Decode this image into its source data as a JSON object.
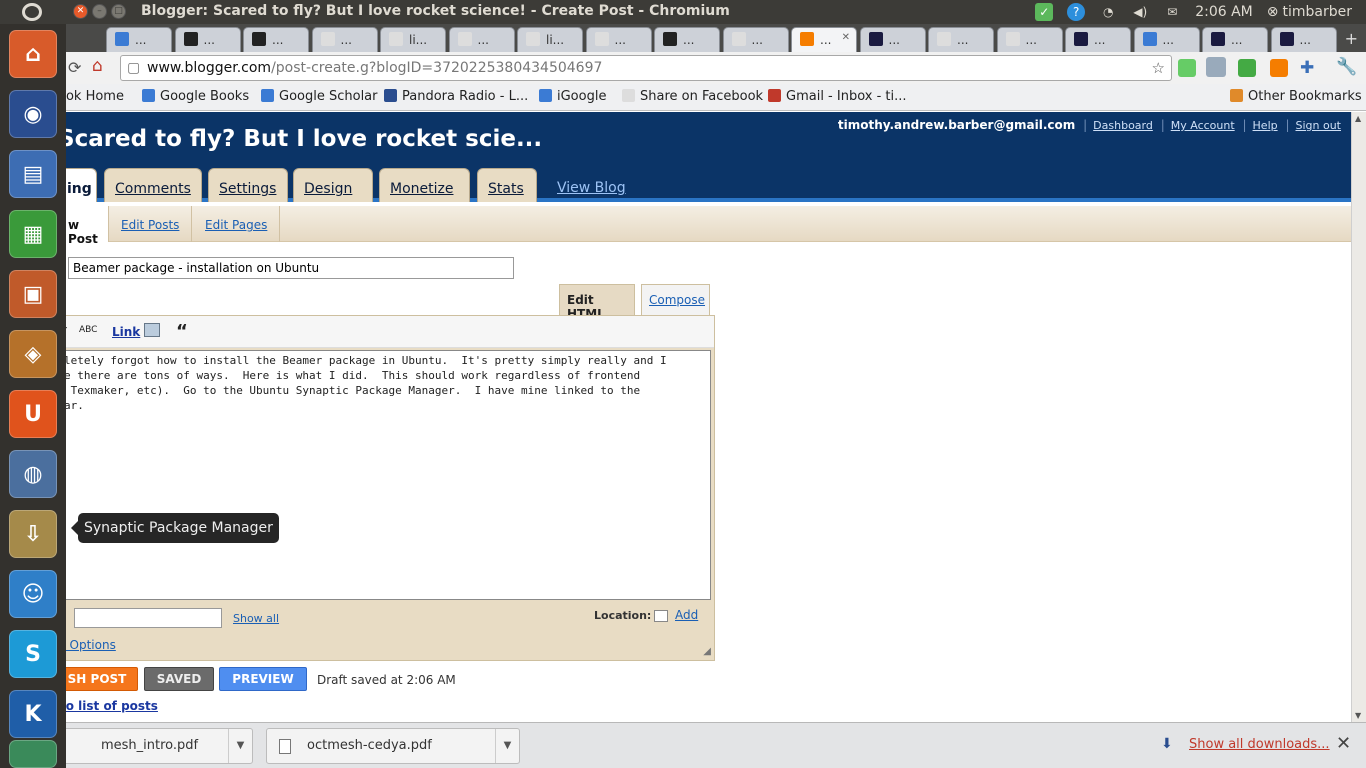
{
  "window": {
    "title": "Blogger: Scared to fly? But I love rocket science! - Create Post - Chromium"
  },
  "panel": {
    "time": "2:06 AM",
    "user": "timbarber"
  },
  "tabs": [
    {
      "label": "...",
      "color": "#3b7bd4"
    },
    {
      "label": "...",
      "color": "#222222"
    },
    {
      "label": "...",
      "color": "#222222"
    },
    {
      "label": "...",
      "color": "#dddddd"
    },
    {
      "label": "li...",
      "color": "#dddddd"
    },
    {
      "label": "...",
      "color": "#dddddd"
    },
    {
      "label": "li...",
      "color": "#dddddd"
    },
    {
      "label": "...",
      "color": "#dddddd"
    },
    {
      "label": "...",
      "color": "#222222"
    },
    {
      "label": "...",
      "color": "#dddddd"
    },
    {
      "label": "...",
      "color": "#f57d00"
    },
    {
      "label": "...",
      "color": "#1a1a40"
    },
    {
      "label": "...",
      "color": "#dddddd"
    },
    {
      "label": "...",
      "color": "#dddddd"
    },
    {
      "label": "...",
      "color": "#1a1a40"
    },
    {
      "label": "...",
      "color": "#3b7bd4"
    },
    {
      "label": "...",
      "color": "#1a1a40"
    },
    {
      "label": "...",
      "color": "#1a1a40"
    }
  ],
  "omnibox": {
    "host": "www.blogger.com",
    "path": "/post-create.g?blogID=3720225380434504697"
  },
  "bookmarks": [
    {
      "label": "ook Home"
    },
    {
      "label": "Google Books"
    },
    {
      "label": "Google Scholar"
    },
    {
      "label": "Pandora Radio - L..."
    },
    {
      "label": "iGoogle"
    },
    {
      "label": "Share on Facebook"
    },
    {
      "label": "Gmail - Inbox - ti..."
    }
  ],
  "other_bookmarks": "Other Bookmarks",
  "blog": {
    "title": "Scared to fly? But I love rocket scie...",
    "email": "timothy.andrew.barber@gmail.com",
    "links": [
      "Dashboard",
      "My Account",
      "Help",
      "Sign out"
    ],
    "tabs": [
      "ing",
      "Comments",
      "Settings",
      "Design",
      "Monetize",
      "Stats"
    ],
    "view_blog": "View Blog",
    "subtabs": [
      "w Post",
      "Edit Posts",
      "Edit Pages"
    ]
  },
  "editor": {
    "post_title": "Beamer package - installation on Ubuntu",
    "mode_tabs": {
      "html": "Edit HTML",
      "compose": "Compose"
    },
    "tool_link": "Link",
    "body": "letely forgot how to install the Beamer package in Ubuntu.  It's pretty simply really and I\ne there are tons of ways.  Here is what I did.  This should work regardless of frontend\n Texmaker, etc).  Go to the Ubuntu Synaptic Package Manager.  I have mine linked to the\nar.",
    "labels_show_all": "Show all",
    "location_label": "Location:",
    "location_add": "Add",
    "options_link": "t Options"
  },
  "actions": {
    "publish": "SH POST",
    "saved": "SAVED",
    "preview": "PREVIEW",
    "draft_status": "Draft saved at 2:06 AM",
    "back": "to list of posts"
  },
  "downloads": {
    "items": [
      {
        "name": "mesh_intro.pdf"
      },
      {
        "name": "octmesh-cedya.pdf"
      }
    ],
    "show_all": "Show all downloads..."
  },
  "launcher": {
    "tooltip": "Synaptic Package Manager"
  }
}
